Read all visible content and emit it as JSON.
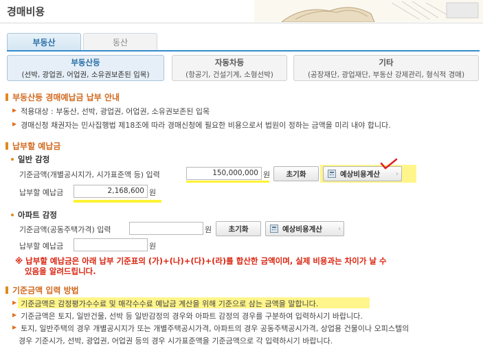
{
  "page": {
    "title": "경매비용"
  },
  "main_tabs": [
    {
      "label": "부동산",
      "active": true
    },
    {
      "label": "동산",
      "active": false
    }
  ],
  "sub_tabs": [
    {
      "title": "부동산등",
      "desc": "(선박, 광업권, 어업권, 소유권보존된 입목)",
      "active": true
    },
    {
      "title": "자동차등",
      "desc": "(항공기, 건설기계, 소형선박)",
      "active": false
    },
    {
      "title": "기타",
      "desc": "(공장재단, 광업재단, 부동산 강제관리, 형식적 경매)",
      "active": false
    }
  ],
  "notice": {
    "heading": "부동산등 경매예납금 납부 안내",
    "lines": [
      "적용대상 : 부동산, 선박, 광업권, 어업권, 소유권보존된 입목",
      "경매신청 채권자는 민사집행법 제18조에 따라 경매신청에 필요한 비용으로서 법원이 정하는 금액을 미리 내야 합니다."
    ]
  },
  "deposit": {
    "heading": "납부할 예납금",
    "general": {
      "title": "일반 감정",
      "base_label": "기준금액(개별공시지가, 시가표준액 등) 입력",
      "base_value": "150,000,000",
      "unit": "원",
      "reset_label": "초기화",
      "calc_label": "예상비용계산",
      "pay_label": "납부할 예납금",
      "pay_value": "2,168,600"
    },
    "apartment": {
      "title": "아파트 감정",
      "base_label": "기준금액(공동주택가격) 입력",
      "base_value": "",
      "unit": "원",
      "reset_label": "초기화",
      "calc_label": "예상비용계산",
      "pay_label": "납부할 예납금",
      "pay_value": ""
    },
    "warning_line1": "※ 납부할 예납금은 아래 납부 기준표의 (가)+(나)+(다)+(라)를 합산한 금액이며, 실제 비용과는 차이가 날 수",
    "warning_line2": "있음을 알려드립니다."
  },
  "method": {
    "heading": "기준금액 입력 방법",
    "line1": "기준금액은 감정평가수수료 및 매각수수료 예납금 계산을 위해 기준으로 삼는 금액을 말합니다.",
    "line2": "기준금액은 토지, 일반건물, 선박 등 일반감정의 경우와 아파트 감정의 경우를 구분하여 입력하시기 바랍니다.",
    "line3a": "토지, 일반주택의 경우 개별공시지가 또는 개별주택공시가격, 아파트의 경우 공동주택공시가격, 상업용 건물이나 오피스텔의",
    "line3b": "경우 기준시가, 선박, 광업권, 어업권 등의 경우 시가표준액을 기준금액으로 각 입력하시기 바랍니다."
  },
  "colors": {
    "accent": "#2f8acb",
    "section": "#d2691e",
    "warning": "#d9230f",
    "highlight": "#fff233"
  },
  "icons": [
    "calculator-icon",
    "chevron-right-icon",
    "arrow-bullet-icon",
    "checkmark-icon"
  ]
}
